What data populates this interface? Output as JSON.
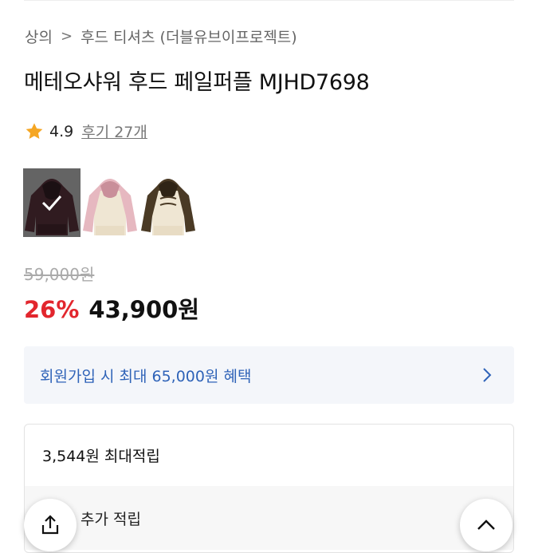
{
  "breadcrumb": {
    "root": "상의",
    "separator": ">",
    "category": "후드 티셔츠 (더블유브이프로젝트)"
  },
  "product": {
    "title": "메테오샤워 후드 페일퍼플 MJHD7698"
  },
  "rating": {
    "icon": "star-icon",
    "score": "4.9",
    "reviews_label": "후기 27개",
    "star_color": "#f5a623"
  },
  "color_options": [
    {
      "name": "option-1",
      "selected": true
    },
    {
      "name": "option-2",
      "selected": false
    },
    {
      "name": "option-3",
      "selected": false
    }
  ],
  "price": {
    "original": "59,000원",
    "discount_rate": "26%",
    "current": "43,900원",
    "discount_color": "#e2262d"
  },
  "benefit": {
    "text": "회원가입 시 최대 65,000원 혜택",
    "icon": "chevron-right-icon",
    "text_color": "#2f63b8"
  },
  "points": {
    "max": "3,544원 최대적립",
    "extra": "추가 적립"
  },
  "floating": {
    "share_icon": "share-icon",
    "scroll_top_icon": "chevron-up-icon"
  }
}
